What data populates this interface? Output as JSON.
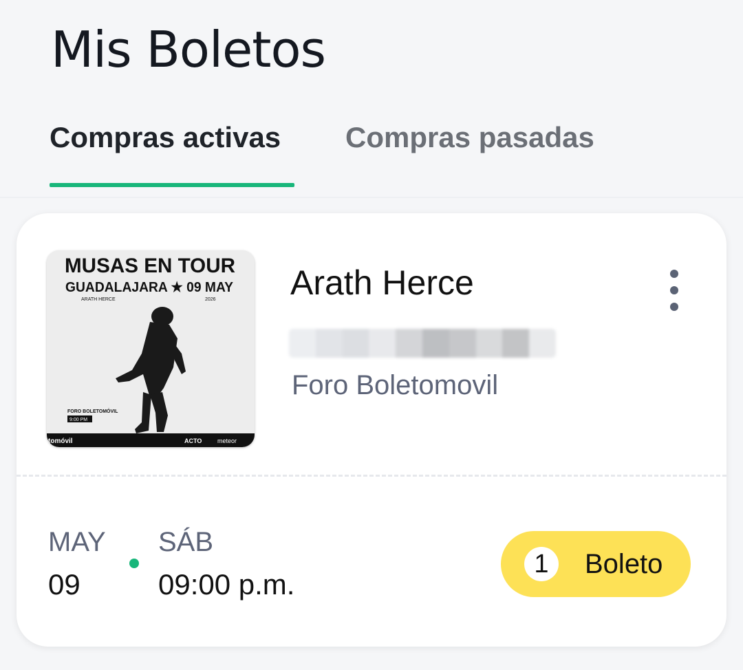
{
  "header": {
    "title": "Mis Boletos"
  },
  "tabs": [
    {
      "label": "Compras activas",
      "active": true
    },
    {
      "label": "Compras pasadas",
      "active": false
    }
  ],
  "colors": {
    "accent": "#18b67a",
    "ticket_pill": "#fde156",
    "muted_text": "#5d6478"
  },
  "card": {
    "title": "Arath Herce",
    "venue": "Foro Boletomovil",
    "poster": {
      "headline": "MUSAS EN TOUR",
      "subline": "GUADALAJARA ★ 09 MAY",
      "artist": "ARATH HERCE",
      "year": "2026",
      "venue": "FORO BOLETOMÓVIL",
      "time": "9:00 PM",
      "brand_left": "tomóvil",
      "brand_right_1": "ACTO",
      "brand_right_2": "meteor"
    },
    "menu_icon": "kebab-menu-icon",
    "date": {
      "month": "MAY",
      "day": "09",
      "weekday": "SÁB",
      "time": "09:00 p.m."
    },
    "tickets": {
      "count": "1",
      "label": "Boleto"
    }
  }
}
